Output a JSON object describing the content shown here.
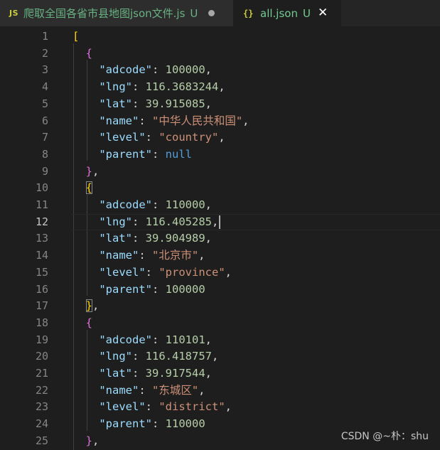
{
  "tabs": [
    {
      "icon": "JS",
      "icon_name": "javascript-file-icon",
      "label": "爬取全国各省市县地图json文件.js",
      "badge": "U",
      "modified": true,
      "active": false
    },
    {
      "icon": "{}",
      "icon_name": "json-file-icon",
      "label": "all.json",
      "badge": "U",
      "close": "✕",
      "active": true
    }
  ],
  "editor": {
    "current_line": 12,
    "lines": [
      {
        "n": "1",
        "tokens": [
          [
            "[",
            "bracket-y"
          ]
        ]
      },
      {
        "n": "2",
        "tokens": [
          [
            "  ",
            ""
          ],
          [
            "{",
            "bracket-p"
          ]
        ]
      },
      {
        "n": "3",
        "tokens": [
          [
            "    ",
            ""
          ],
          [
            "\"adcode\"",
            "key"
          ],
          [
            ": ",
            "punc"
          ],
          [
            "100000",
            "num"
          ],
          [
            ",",
            "punc"
          ]
        ]
      },
      {
        "n": "4",
        "tokens": [
          [
            "    ",
            ""
          ],
          [
            "\"lng\"",
            "key"
          ],
          [
            ": ",
            "punc"
          ],
          [
            "116.3683244",
            "num"
          ],
          [
            ",",
            "punc"
          ]
        ]
      },
      {
        "n": "5",
        "tokens": [
          [
            "    ",
            ""
          ],
          [
            "\"lat\"",
            "key"
          ],
          [
            ": ",
            "punc"
          ],
          [
            "39.915085",
            "num"
          ],
          [
            ",",
            "punc"
          ]
        ]
      },
      {
        "n": "6",
        "tokens": [
          [
            "    ",
            ""
          ],
          [
            "\"name\"",
            "key"
          ],
          [
            ": ",
            "punc"
          ],
          [
            "\"中华人民共和国\"",
            "str"
          ],
          [
            ",",
            "punc"
          ]
        ]
      },
      {
        "n": "7",
        "tokens": [
          [
            "    ",
            ""
          ],
          [
            "\"level\"",
            "key"
          ],
          [
            ": ",
            "punc"
          ],
          [
            "\"country\"",
            "str"
          ],
          [
            ",",
            "punc"
          ]
        ]
      },
      {
        "n": "8",
        "tokens": [
          [
            "    ",
            ""
          ],
          [
            "\"parent\"",
            "key"
          ],
          [
            ": ",
            "punc"
          ],
          [
            "null",
            "kw"
          ]
        ]
      },
      {
        "n": "9",
        "tokens": [
          [
            "  ",
            ""
          ],
          [
            "}",
            "bracket-p"
          ],
          [
            ",",
            "punc"
          ]
        ]
      },
      {
        "n": "10",
        "tokens": [
          [
            "  ",
            ""
          ],
          [
            "{",
            "bracket-y bm"
          ]
        ]
      },
      {
        "n": "11",
        "tokens": [
          [
            "    ",
            ""
          ],
          [
            "\"adcode\"",
            "key"
          ],
          [
            ": ",
            "punc"
          ],
          [
            "110000",
            "num"
          ],
          [
            ",",
            "punc"
          ]
        ]
      },
      {
        "n": "12",
        "tokens": [
          [
            "    ",
            ""
          ],
          [
            "\"lng\"",
            "key"
          ],
          [
            ": ",
            "punc"
          ],
          [
            "116.405285",
            "num"
          ],
          [
            ",",
            "punc"
          ]
        ],
        "cursor": true
      },
      {
        "n": "13",
        "tokens": [
          [
            "    ",
            ""
          ],
          [
            "\"lat\"",
            "key"
          ],
          [
            ": ",
            "punc"
          ],
          [
            "39.904989",
            "num"
          ],
          [
            ",",
            "punc"
          ]
        ]
      },
      {
        "n": "14",
        "tokens": [
          [
            "    ",
            ""
          ],
          [
            "\"name\"",
            "key"
          ],
          [
            ": ",
            "punc"
          ],
          [
            "\"北京市\"",
            "str"
          ],
          [
            ",",
            "punc"
          ]
        ]
      },
      {
        "n": "15",
        "tokens": [
          [
            "    ",
            ""
          ],
          [
            "\"level\"",
            "key"
          ],
          [
            ": ",
            "punc"
          ],
          [
            "\"province\"",
            "str"
          ],
          [
            ",",
            "punc"
          ]
        ]
      },
      {
        "n": "16",
        "tokens": [
          [
            "    ",
            ""
          ],
          [
            "\"parent\"",
            "key"
          ],
          [
            ": ",
            "punc"
          ],
          [
            "100000",
            "num"
          ]
        ]
      },
      {
        "n": "17",
        "tokens": [
          [
            "  ",
            ""
          ],
          [
            "}",
            "bracket-y bm"
          ],
          [
            ",",
            "punc"
          ]
        ]
      },
      {
        "n": "18",
        "tokens": [
          [
            "  ",
            ""
          ],
          [
            "{",
            "bracket-p"
          ]
        ]
      },
      {
        "n": "19",
        "tokens": [
          [
            "    ",
            ""
          ],
          [
            "\"adcode\"",
            "key"
          ],
          [
            ": ",
            "punc"
          ],
          [
            "110101",
            "num"
          ],
          [
            ",",
            "punc"
          ]
        ]
      },
      {
        "n": "20",
        "tokens": [
          [
            "    ",
            ""
          ],
          [
            "\"lng\"",
            "key"
          ],
          [
            ": ",
            "punc"
          ],
          [
            "116.418757",
            "num"
          ],
          [
            ",",
            "punc"
          ]
        ]
      },
      {
        "n": "21",
        "tokens": [
          [
            "    ",
            ""
          ],
          [
            "\"lat\"",
            "key"
          ],
          [
            ": ",
            "punc"
          ],
          [
            "39.917544",
            "num"
          ],
          [
            ",",
            "punc"
          ]
        ]
      },
      {
        "n": "22",
        "tokens": [
          [
            "    ",
            ""
          ],
          [
            "\"name\"",
            "key"
          ],
          [
            ": ",
            "punc"
          ],
          [
            "\"东城区\"",
            "str"
          ],
          [
            ",",
            "punc"
          ]
        ]
      },
      {
        "n": "23",
        "tokens": [
          [
            "    ",
            ""
          ],
          [
            "\"level\"",
            "key"
          ],
          [
            ": ",
            "punc"
          ],
          [
            "\"district\"",
            "str"
          ],
          [
            ",",
            "punc"
          ]
        ]
      },
      {
        "n": "24",
        "tokens": [
          [
            "    ",
            ""
          ],
          [
            "\"parent\"",
            "key"
          ],
          [
            ": ",
            "punc"
          ],
          [
            "110000",
            "num"
          ]
        ]
      },
      {
        "n": "25",
        "tokens": [
          [
            "  ",
            ""
          ],
          [
            "}",
            "bracket-p"
          ],
          [
            ",",
            "punc"
          ]
        ]
      }
    ]
  },
  "watermark": "CSDN @~朴：shu",
  "colors": {
    "background": "#1e1e1e",
    "key": "#9cdcfe",
    "number": "#b5cea8",
    "string": "#ce9178",
    "keyword": "#569cd6",
    "bracket_gold": "#ffd700",
    "bracket_orchid": "#da70d6",
    "untracked": "#73c991"
  }
}
